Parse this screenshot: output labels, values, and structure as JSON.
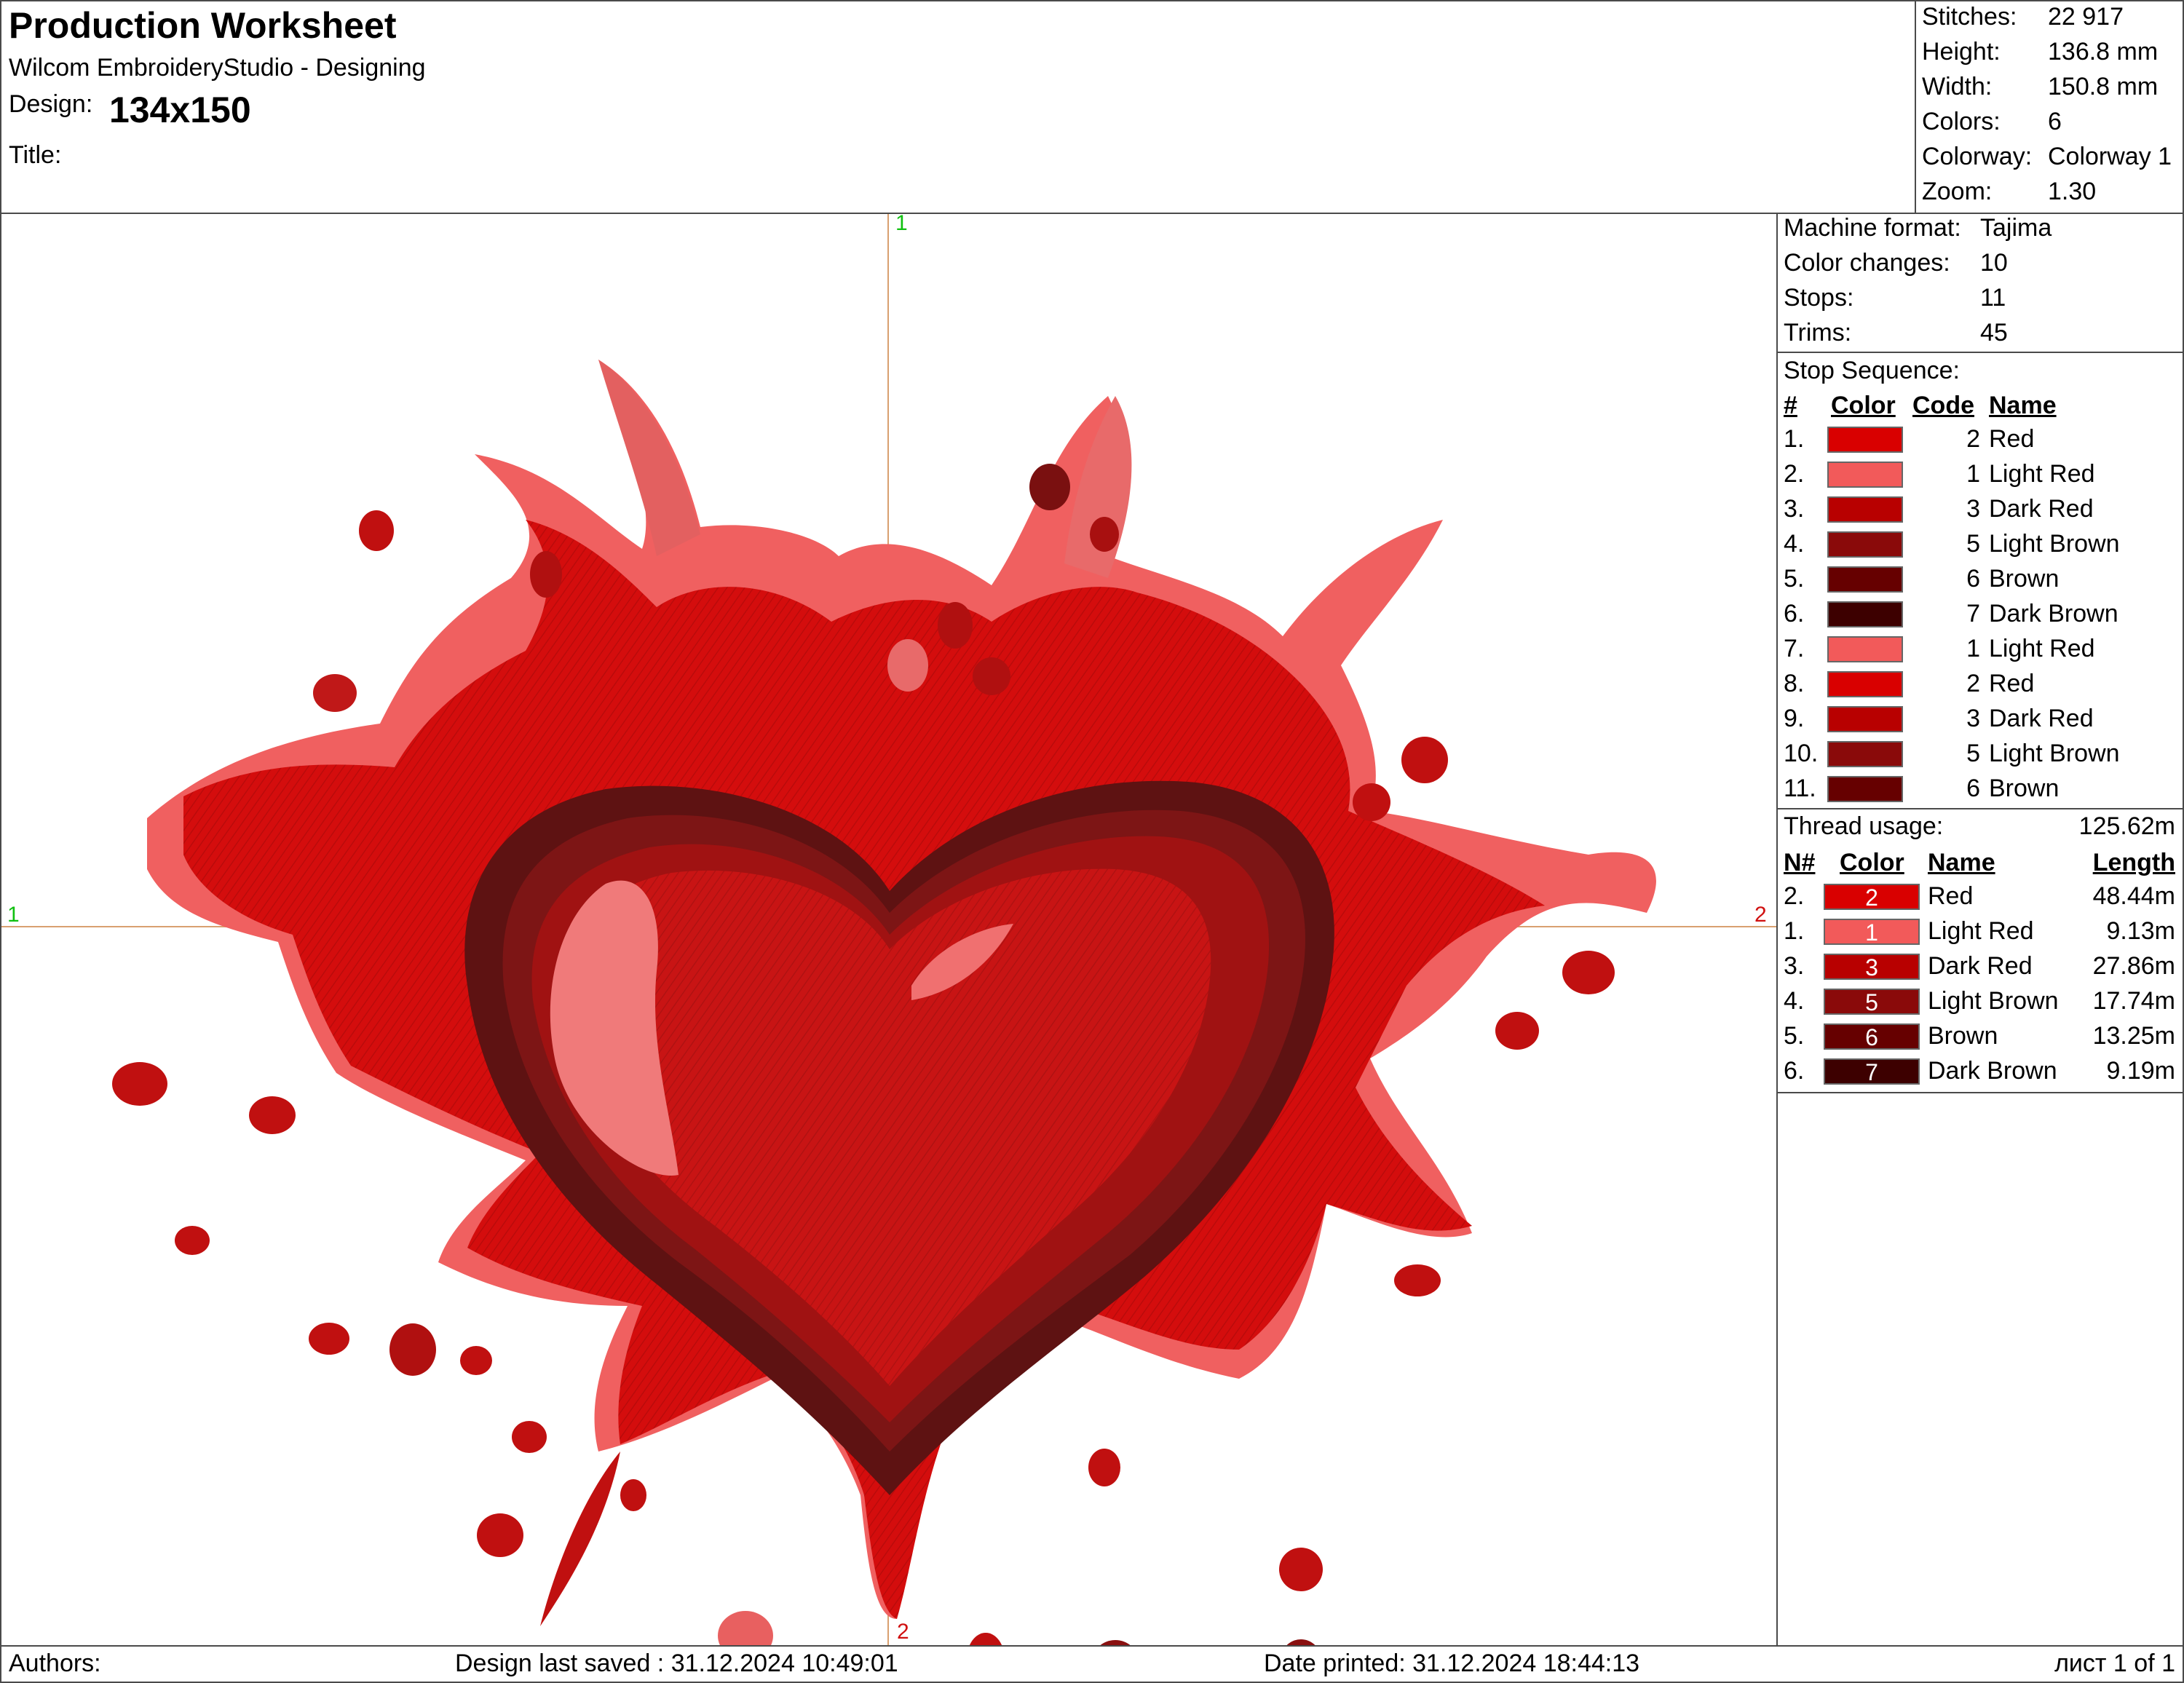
{
  "header": {
    "title": "Production Worksheet",
    "app": "Wilcom EmbroideryStudio - Designing",
    "design_label": "Design:",
    "design_value": "134x150",
    "title_label": "Title:"
  },
  "summary": [
    {
      "label": "Stitches:",
      "value": "22 917"
    },
    {
      "label": "Height:",
      "value": "136.8 mm"
    },
    {
      "label": "Width:",
      "value": "150.8 mm"
    },
    {
      "label": "Colors:",
      "value": "6"
    },
    {
      "label": "Colorway:",
      "value": "Colorway 1"
    },
    {
      "label": "Zoom:",
      "value": "1.30"
    }
  ],
  "machine": [
    {
      "label": "Machine format:",
      "value": "Tajima"
    },
    {
      "label": "Color changes:",
      "value": "10"
    },
    {
      "label": "Stops:",
      "value": "11"
    },
    {
      "label": "Trims:",
      "value": "45"
    }
  ],
  "stop_sequence": {
    "title": "Stop Sequence:",
    "headers": {
      "num": "#",
      "color": "Color",
      "code": "Code",
      "name": "Name"
    },
    "rows": [
      {
        "n": "1.",
        "color": "#d90000",
        "code": "2",
        "name": "Red"
      },
      {
        "n": "2.",
        "color": "#f25a5a",
        "code": "1",
        "name": "Light Red"
      },
      {
        "n": "3.",
        "color": "#b80000",
        "code": "3",
        "name": "Dark Red"
      },
      {
        "n": "4.",
        "color": "#8a0a0a",
        "code": "5",
        "name": "Light Brown"
      },
      {
        "n": "5.",
        "color": "#660000",
        "code": "6",
        "name": "Brown"
      },
      {
        "n": "6.",
        "color": "#3d0000",
        "code": "7",
        "name": "Dark Brown"
      },
      {
        "n": "7.",
        "color": "#f25a5a",
        "code": "1",
        "name": "Light Red"
      },
      {
        "n": "8.",
        "color": "#d90000",
        "code": "2",
        "name": "Red"
      },
      {
        "n": "9.",
        "color": "#b80000",
        "code": "3",
        "name": "Dark Red"
      },
      {
        "n": "10.",
        "color": "#8a0a0a",
        "code": "5",
        "name": "Light Brown"
      },
      {
        "n": "11.",
        "color": "#660000",
        "code": "6",
        "name": "Brown"
      }
    ]
  },
  "thread_usage": {
    "label": "Thread usage:",
    "total": "125.62m",
    "headers": {
      "num": "N#",
      "color": "Color",
      "name": "Name",
      "length": "Length"
    },
    "rows": [
      {
        "n": "2.",
        "color": "#d90000",
        "code": "2",
        "name": "Red",
        "length": "48.44m"
      },
      {
        "n": "1.",
        "color": "#f25a5a",
        "code": "1",
        "name": "Light Red",
        "length": "9.13m"
      },
      {
        "n": "3.",
        "color": "#b80000",
        "code": "3",
        "name": "Dark Red",
        "length": "27.86m"
      },
      {
        "n": "4.",
        "color": "#8a0a0a",
        "code": "5",
        "name": "Light Brown",
        "length": "17.74m"
      },
      {
        "n": "5.",
        "color": "#660000",
        "code": "6",
        "name": "Brown",
        "length": "13.25m"
      },
      {
        "n": "6.",
        "color": "#3d0000",
        "code": "7",
        "name": "Dark Brown",
        "length": "9.19m"
      }
    ]
  },
  "axes": {
    "top": "1",
    "left": "1",
    "right": "2",
    "bottom": "2"
  },
  "footer": {
    "authors": "Authors:",
    "saved": "Design last saved : 31.12.2024 10:49:01",
    "printed": "Date printed: 31.12.2024 18:44:13",
    "page": "лист 1 of 1"
  }
}
